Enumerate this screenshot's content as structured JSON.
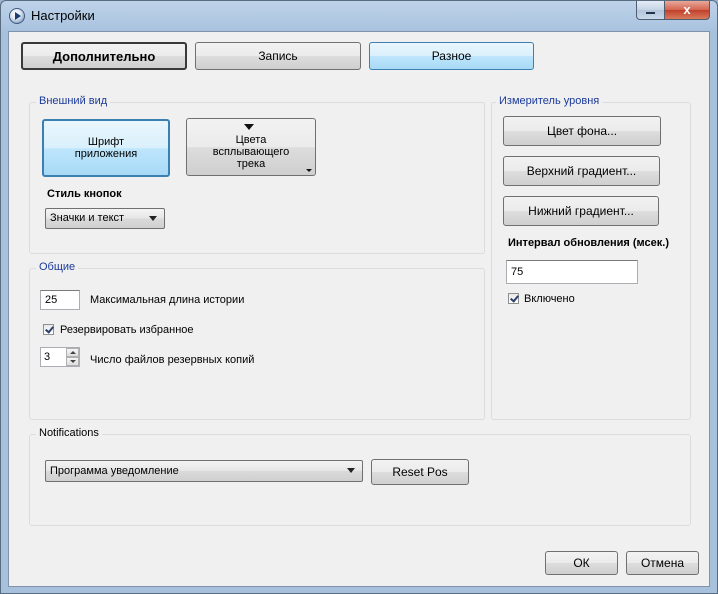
{
  "window": {
    "title": "Настройки",
    "minimize_icon": "minimize-icon",
    "close_icon": "close-icon",
    "close_glyph": "x"
  },
  "tabs": {
    "dop": "Дополнительно",
    "zap": "Запись",
    "raz": "Разное"
  },
  "appearance": {
    "title": "Внешний вид",
    "font_button": "Шрифт\nприложения",
    "popup_colors_button": "Цвета\nвсплывающего\nтрека",
    "button_style_label": "Стиль кнопок",
    "button_style_value": "Значки и текст"
  },
  "general": {
    "title": "Общие",
    "history_value": "25",
    "history_label": "Максимальная длина истории",
    "reserve_favorites_label": "Резервировать избранное",
    "backup_files_value": "3",
    "backup_files_label": "Число файлов резервных копий"
  },
  "meter": {
    "title": "Измеритель уровня",
    "bg_color_button": "Цвет фона...",
    "top_gradient_button": "Верхний градиент...",
    "bottom_gradient_button": "Нижний градиент...",
    "interval_label": "Интервал обновления (мсек.)",
    "interval_value": "75",
    "enabled_label": "Включено"
  },
  "notifications": {
    "title": "Notifications",
    "program_value": "Программа уведомление",
    "reset_pos_button": "Reset Pos"
  },
  "footer": {
    "ok": "ОК",
    "cancel": "Отмена"
  }
}
